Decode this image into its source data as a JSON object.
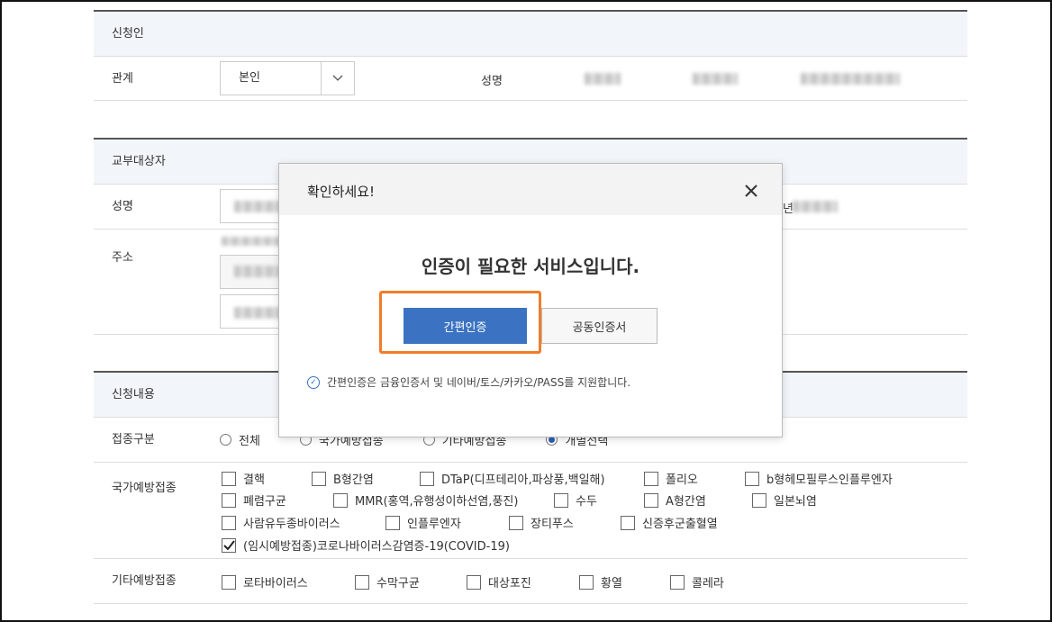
{
  "applicant": {
    "header": "신청인",
    "relation_label": "관계",
    "relation_value": "본인",
    "name_label": "성명"
  },
  "recipient": {
    "header": "교부대상자",
    "name_label": "성명",
    "address_label": "주소",
    "side_label_fragment": "년"
  },
  "request": {
    "header": "신청내용",
    "type_label": "접종구분",
    "type_options": [
      {
        "label": "전체",
        "selected": false
      },
      {
        "label": "국가예방접종",
        "selected": false
      },
      {
        "label": "기타예방접종",
        "selected": false
      },
      {
        "label": "개별선택",
        "selected": true
      }
    ],
    "national_label": "국가예방접종",
    "national_items": [
      {
        "label": "결핵",
        "checked": false
      },
      {
        "label": "B형간염",
        "checked": false
      },
      {
        "label": "DTaP(디프테리아,파상풍,백일해)",
        "checked": false
      },
      {
        "label": "폴리오",
        "checked": false
      },
      {
        "label": "b형헤모필루스인플루엔자",
        "checked": false
      },
      {
        "label": "폐렴구균",
        "checked": false
      },
      {
        "label": "MMR(홍역,유행성이하선염,풍진)",
        "checked": false
      },
      {
        "label": "수두",
        "checked": false
      },
      {
        "label": "A형간염",
        "checked": false
      },
      {
        "label": "일본뇌염",
        "checked": false
      },
      {
        "label": "사람유두종바이러스",
        "checked": false
      },
      {
        "label": "인플루엔자",
        "checked": false
      },
      {
        "label": "장티푸스",
        "checked": false
      },
      {
        "label": "신증후군출혈열",
        "checked": false
      },
      {
        "label": "(임시예방접종)코로나바이러스감염증-19(COVID-19)",
        "checked": true
      }
    ],
    "other_label": "기타예방접종",
    "other_items": [
      {
        "label": "로타바이러스",
        "checked": false
      },
      {
        "label": "수막구균",
        "checked": false
      },
      {
        "label": "대상포진",
        "checked": false
      },
      {
        "label": "황열",
        "checked": false
      },
      {
        "label": "콜레라",
        "checked": false
      }
    ]
  },
  "modal": {
    "title": "확인하세요!",
    "message": "인증이 필요한 서비스입니다.",
    "primary_button": "간편인증",
    "secondary_button": "공동인증서",
    "note": "간편인증은 금융인증서 및 네이버/토스/카카오/PASS를 지원합니다.",
    "highlight_color": "#f07d2a",
    "primary_color": "#3b73c2"
  }
}
